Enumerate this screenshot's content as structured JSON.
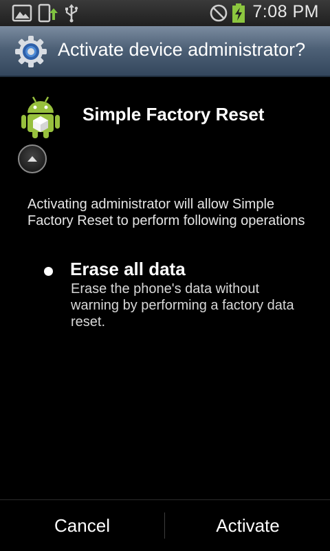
{
  "status_bar": {
    "time": "7:08 PM",
    "left_icons": [
      "gallery-icon",
      "upload-icon",
      "usb-icon"
    ],
    "right_icons": [
      "no-signal-icon",
      "battery-charging-icon"
    ],
    "battery_color": "#8cc63f"
  },
  "dialog": {
    "title": "Activate device administrator?",
    "title_icon": "settings-gear-icon"
  },
  "app": {
    "name": "Simple Factory Reset",
    "icon": "android-robot-icon"
  },
  "description": "Activating administrator will allow Simple Factory Reset to perform following operations",
  "policies": [
    {
      "title": "Erase all data",
      "description": "Erase the phone's data without warning by performing a factory data reset."
    }
  ],
  "buttons": {
    "cancel": "Cancel",
    "activate": "Activate"
  }
}
